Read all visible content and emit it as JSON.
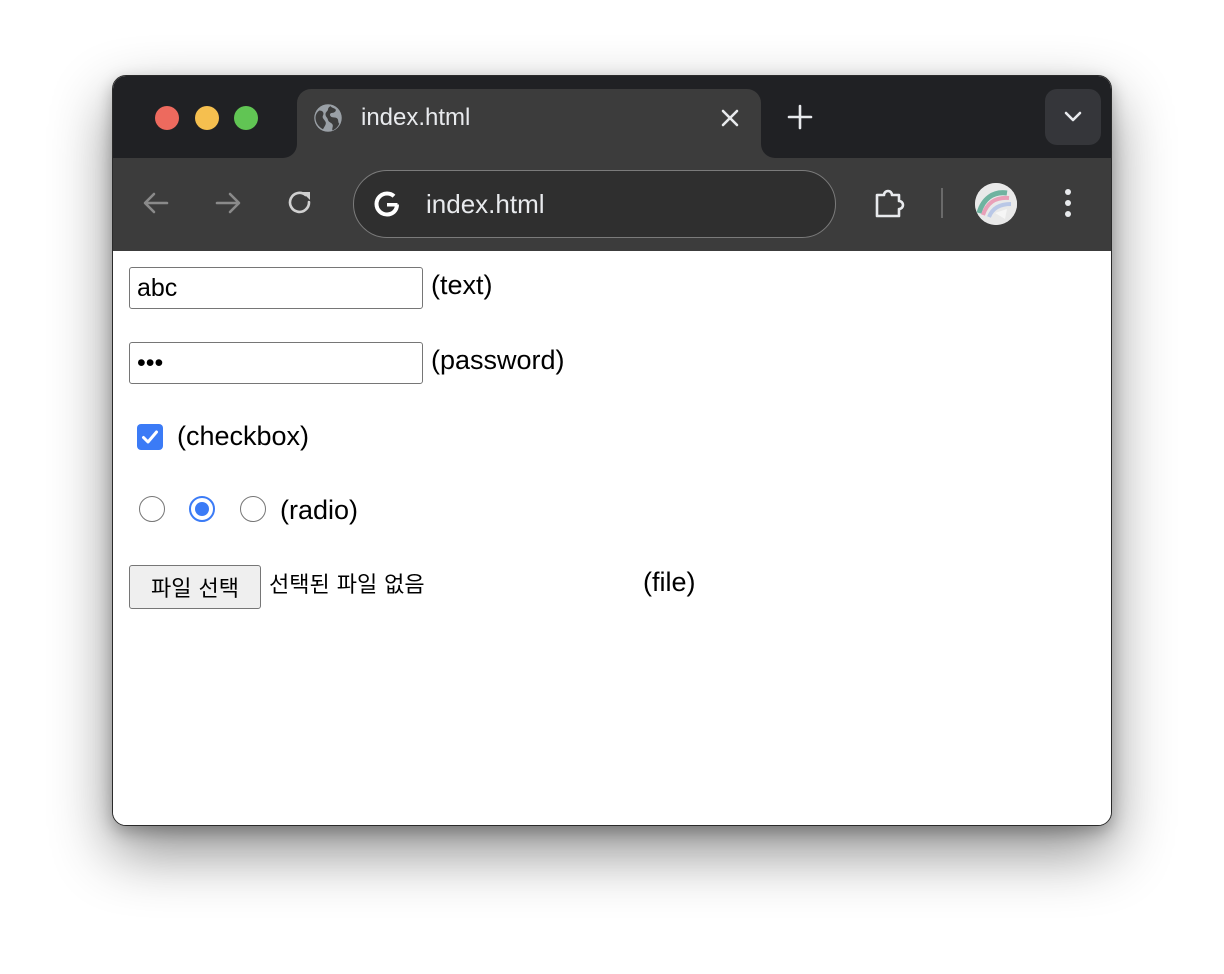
{
  "browser": {
    "tab": {
      "title": "index.html",
      "favicon": "globe-icon"
    },
    "address_bar": {
      "text": "index.html",
      "search_engine_icon": "google-g-icon"
    },
    "colors": {
      "tabstrip": "#202124",
      "toolbar": "#3c3c3c",
      "traffic_red": "#ed6a5e",
      "traffic_yellow": "#f5bf4f",
      "traffic_green": "#61c554"
    }
  },
  "page": {
    "text_field": {
      "value": "abc",
      "label": "(text)"
    },
    "password_field": {
      "value": "abc",
      "label": "(password)"
    },
    "checkbox": {
      "checked": true,
      "label": "(checkbox)"
    },
    "radio_group": {
      "options": [
        {
          "checked": false
        },
        {
          "checked": true
        },
        {
          "checked": false
        }
      ],
      "label": "(radio)"
    },
    "file_input": {
      "button_label": "파일 선택",
      "status": "선택된 파일 없음",
      "label": "(file)"
    },
    "accent_color": "#3b7bf6"
  }
}
